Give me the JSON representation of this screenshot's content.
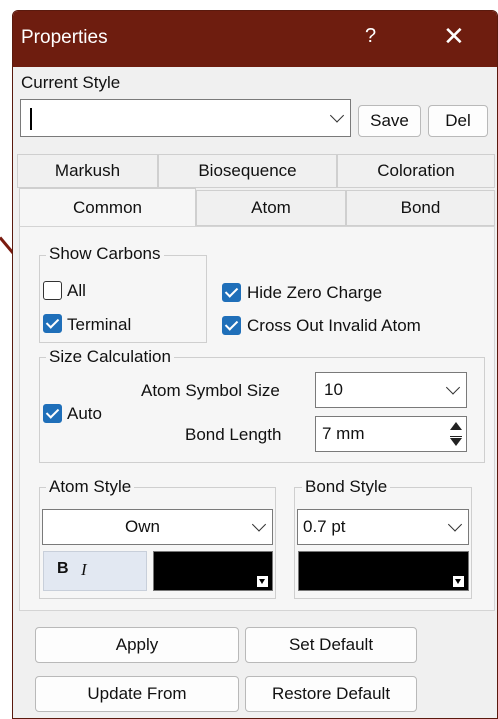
{
  "titlebar": {
    "title": "Properties",
    "help": "?",
    "close": "✕"
  },
  "current_style": {
    "label": "Current Style",
    "value": "",
    "save": "Save",
    "del": "Del"
  },
  "tabs": {
    "row1": [
      "Markush",
      "Biosequence",
      "Coloration"
    ],
    "row2": [
      "Common",
      "Atom",
      "Bond"
    ],
    "active": "Common"
  },
  "show_carbons": {
    "title": "Show Carbons",
    "all": {
      "label": "All",
      "checked": false
    },
    "terminal": {
      "label": "Terminal",
      "checked": true
    }
  },
  "hide_zero_charge": {
    "label": "Hide Zero Charge",
    "checked": true
  },
  "cross_out_invalid": {
    "label": "Cross Out Invalid Atom",
    "checked": true
  },
  "size_calc": {
    "title": "Size Calculation",
    "auto": {
      "label": "Auto",
      "checked": true
    },
    "atom_symbol_size_label": "Atom Symbol Size",
    "atom_symbol_size": "10",
    "bond_length_label": "Bond Length",
    "bond_length": "7 mm"
  },
  "atom_style": {
    "title": "Atom Style",
    "value": "Own",
    "bold": "B",
    "italic": "I",
    "color": "#000000"
  },
  "bond_style": {
    "title": "Bond Style",
    "value": "0.7 pt",
    "color": "#000000"
  },
  "buttons": {
    "apply": "Apply",
    "set_default": "Set Default",
    "update_from": "Update From",
    "restore_default": "Restore Default"
  },
  "colors": {
    "title_bar": "#6e1d0f",
    "accent": "#1f6fb9",
    "annotation_arrow": "#7a1b10"
  }
}
